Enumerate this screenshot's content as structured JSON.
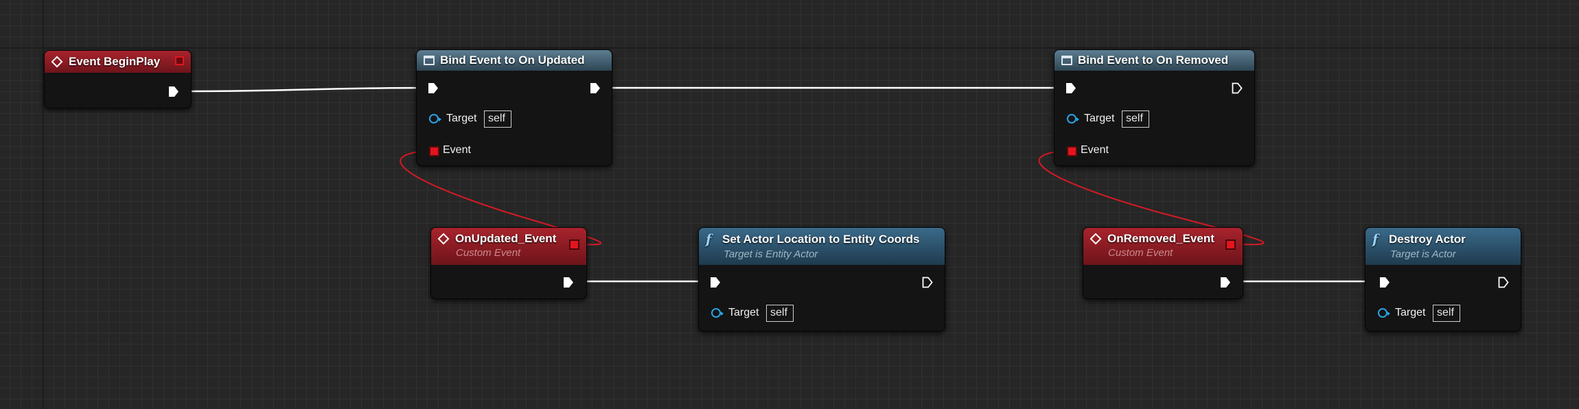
{
  "graph": {
    "colors": {
      "exec_wire": "#ffffff",
      "delegate_wire": "#d41a25",
      "event_header": "#a8232c",
      "bind_header": "#5d7d92",
      "function_header": "#3a6a8a",
      "object_pin": "#2aa3e8"
    },
    "nodes": {
      "begin_play": {
        "title": "Event BeginPlay",
        "icon": "event-diamond-icon"
      },
      "bind_updated": {
        "title": "Bind Event to On Updated",
        "icon": "bind-event-icon",
        "target_label": "Target",
        "target_value": "self",
        "event_label": "Event"
      },
      "bind_removed": {
        "title": "Bind Event to On Removed",
        "icon": "bind-event-icon",
        "target_label": "Target",
        "target_value": "self",
        "event_label": "Event"
      },
      "on_updated": {
        "title": "OnUpdated_Event",
        "subtitle": "Custom Event",
        "icon": "event-diamond-icon"
      },
      "set_location": {
        "title": "Set Actor Location to Entity Coords",
        "subtitle": "Target is Entity Actor",
        "icon": "function-icon",
        "icon_glyph": "f",
        "target_label": "Target",
        "target_value": "self"
      },
      "on_removed": {
        "title": "OnRemoved_Event",
        "subtitle": "Custom Event",
        "icon": "event-diamond-icon"
      },
      "destroy_actor": {
        "title": "Destroy Actor",
        "subtitle": "Target is Actor",
        "icon": "function-icon",
        "icon_glyph": "f",
        "target_label": "Target",
        "target_value": "self"
      }
    }
  }
}
